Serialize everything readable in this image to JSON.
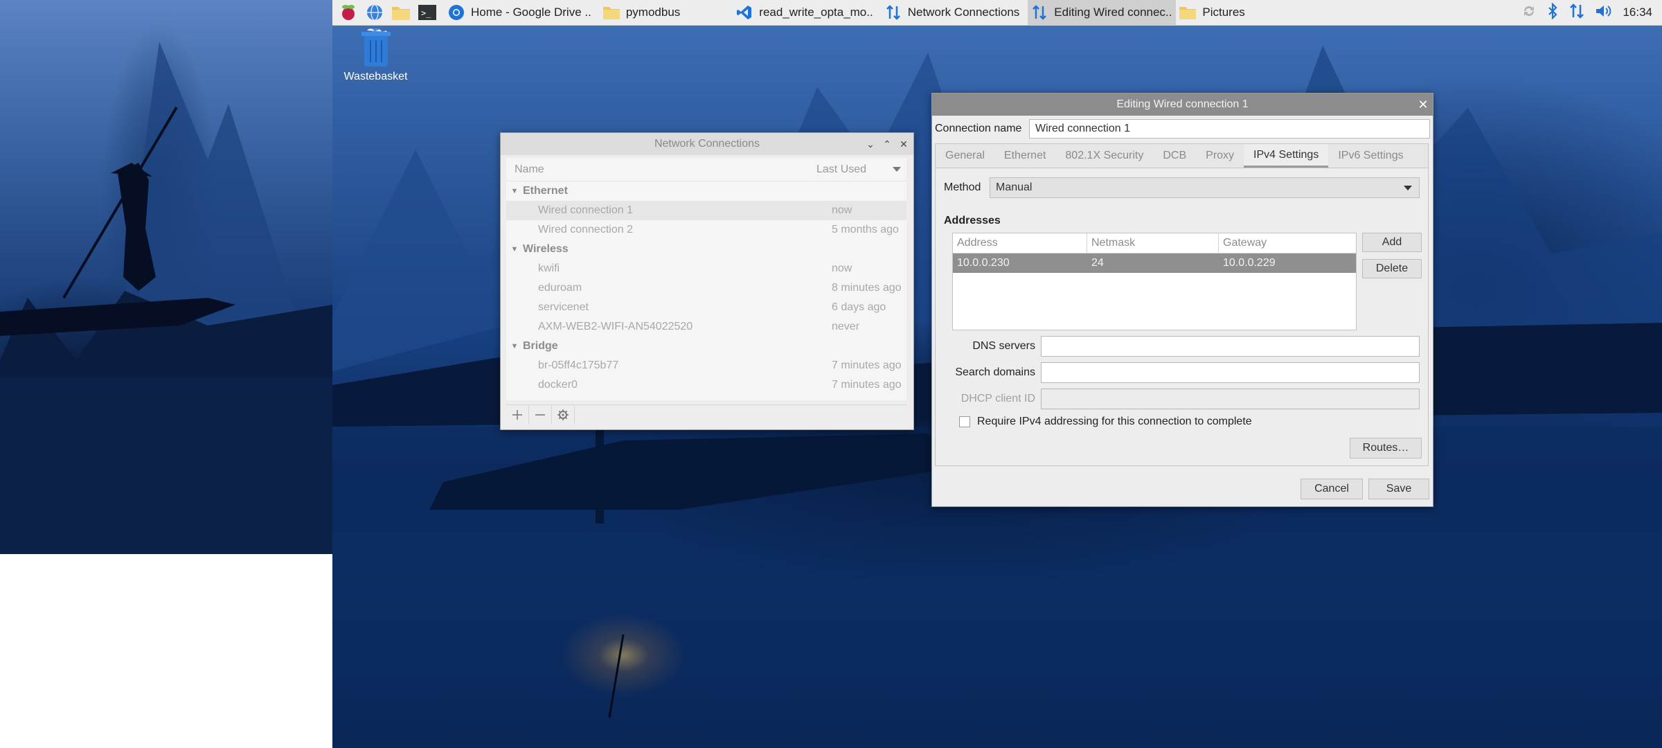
{
  "taskbar": {
    "tasks": [
      {
        "label": "Home - Google Drive ..",
        "icon": "chromium-icon"
      },
      {
        "label": "pymodbus",
        "icon": "folder-icon"
      },
      {
        "label": "read_write_opta_mo..",
        "icon": "vscode-icon"
      },
      {
        "label": "Network Connections",
        "icon": "network-arrows-icon"
      },
      {
        "label": "Editing Wired connec..",
        "icon": "network-arrows-icon"
      },
      {
        "label": "Pictures",
        "icon": "folder-icon"
      }
    ],
    "clock": "16:34",
    "colors": {
      "accent_blue": "#1e73d6",
      "panel_bg": "#ededed"
    }
  },
  "desktop": {
    "wastebasket_label": "Wastebasket"
  },
  "network_connections": {
    "title": "Network Connections",
    "columns": {
      "name": "Name",
      "last_used": "Last Used"
    },
    "groups": [
      {
        "name": "Ethernet",
        "items": [
          {
            "name": "Wired connection 1",
            "last": "now"
          },
          {
            "name": "Wired connection 2",
            "last": "5 months ago"
          }
        ]
      },
      {
        "name": "Wireless",
        "items": [
          {
            "name": "kwifi",
            "last": "now"
          },
          {
            "name": "eduroam",
            "last": "8 minutes ago"
          },
          {
            "name": "servicenet",
            "last": "6 days ago"
          },
          {
            "name": "AXM-WEB2-WIFI-AN54022520",
            "last": "never"
          }
        ]
      },
      {
        "name": "Bridge",
        "items": [
          {
            "name": "br-05ff4c175b77",
            "last": "7 minutes ago"
          },
          {
            "name": "docker0",
            "last": "7 minutes ago"
          }
        ]
      }
    ]
  },
  "editor": {
    "title": "Editing Wired connection 1",
    "connection_name_label": "Connection name",
    "connection_name_value": "Wired connection 1",
    "tabs": [
      "General",
      "Ethernet",
      "802.1X Security",
      "DCB",
      "Proxy",
      "IPv4 Settings",
      "IPv6 Settings"
    ],
    "active_tab": "IPv4 Settings",
    "method_label": "Method",
    "method_value": "Manual",
    "addresses_title": "Addresses",
    "address_columns": {
      "address": "Address",
      "netmask": "Netmask",
      "gateway": "Gateway"
    },
    "address_rows": [
      {
        "address": "10.0.0.230",
        "netmask": "24",
        "gateway": "10.0.0.229"
      }
    ],
    "add_label": "Add",
    "delete_label": "Delete",
    "dns_label": "DNS servers",
    "dns_value": "",
    "search_domains_label": "Search domains",
    "search_domains_value": "",
    "dhcp_client_id_label": "DHCP client ID",
    "dhcp_client_id_value": "",
    "require_ipv4_label": "Require IPv4 addressing for this connection to complete",
    "require_ipv4_checked": false,
    "routes_label": "Routes…",
    "cancel_label": "Cancel",
    "save_label": "Save"
  }
}
